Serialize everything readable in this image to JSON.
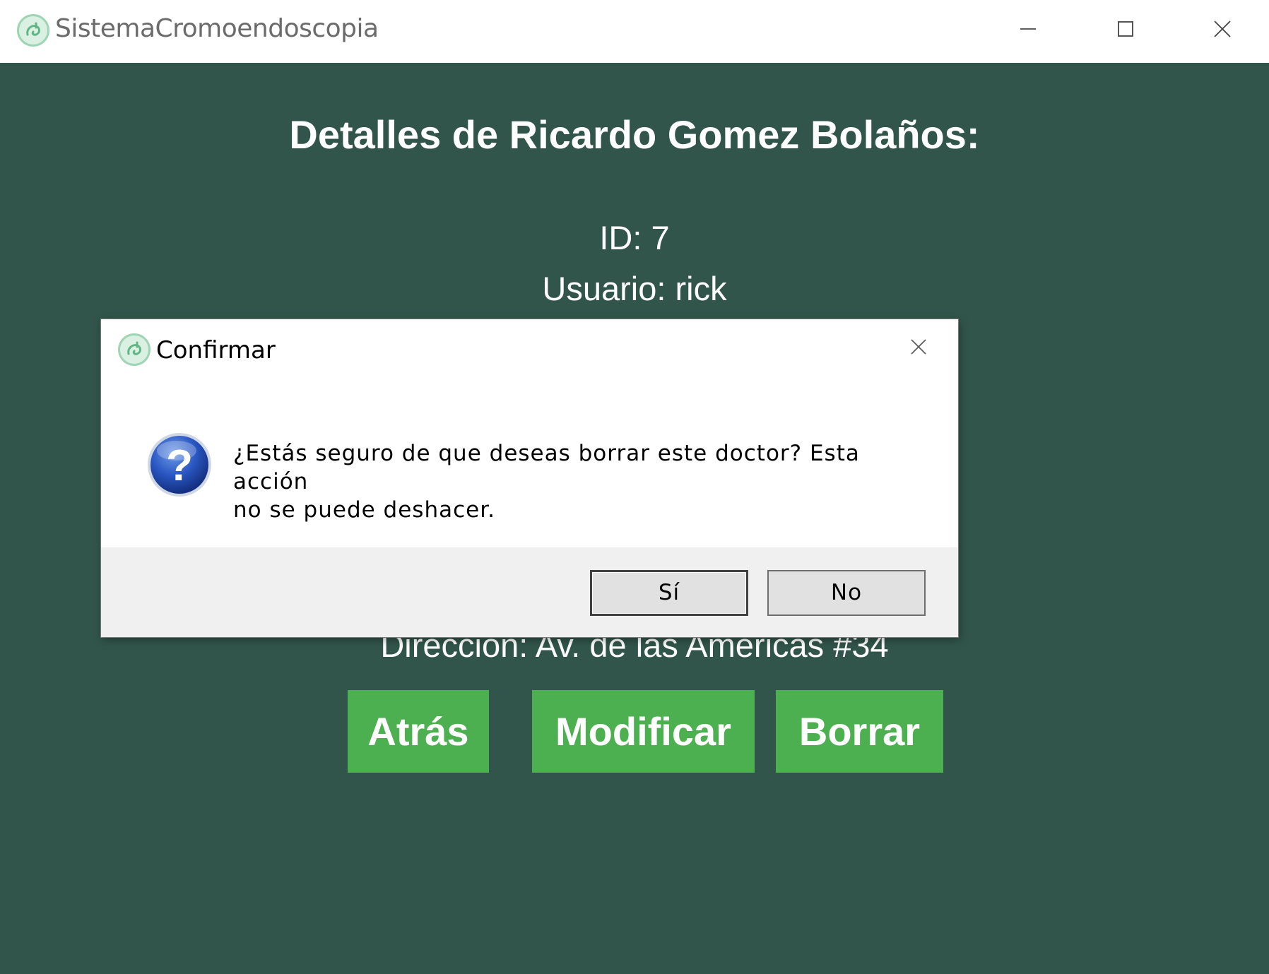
{
  "window": {
    "title": "SistemaCromoendoscopia",
    "icon": "app-logo-icon",
    "controls": [
      "minimize-icon",
      "maximize-icon",
      "close-icon"
    ]
  },
  "details": {
    "heading": "Detalles de Ricardo Gomez Bolaños:",
    "id_line": "ID: 7",
    "usuario_line": "Usuario: rick",
    "direccion_line": "Dirección: Av. de las Americas #34"
  },
  "actions": {
    "atras": "Atrás",
    "modificar": "Modificar",
    "borrar": "Borrar"
  },
  "dialog": {
    "title": "Confirmar",
    "icon": "question-icon",
    "message_line1": "¿Estás seguro de que deseas borrar este doctor? Esta acción",
    "message_line2": "no se puede deshacer.",
    "yes_label": "Sí",
    "no_label": "No"
  },
  "colors": {
    "background": "#31554a",
    "accent_button": "#4caf50",
    "dialog_footer": "#f0f0f0"
  }
}
